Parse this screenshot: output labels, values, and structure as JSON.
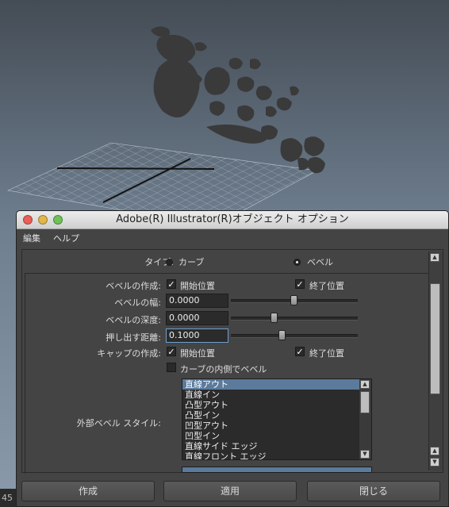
{
  "viewport": {
    "corner_number": "45"
  },
  "dialog": {
    "title": "Adobe(R) Illustrator(R)オブジェクト オプション",
    "menu": {
      "edit": "編集",
      "help": "ヘルプ"
    },
    "type": {
      "label": "タイプ:",
      "options": [
        "カーブ",
        "ベベル"
      ],
      "selected": "ベベル"
    },
    "bevel_create": {
      "label": "ベベルの作成:",
      "start": {
        "label": "開始位置",
        "checked": true
      },
      "end": {
        "label": "終了位置",
        "checked": true
      }
    },
    "bevel_width": {
      "label": "ベベルの幅:",
      "value": "0.0000",
      "slider_position": 0.5
    },
    "bevel_depth": {
      "label": "ベベルの深度:",
      "value": "0.0000",
      "slider_position": 0.33
    },
    "extrude_distance": {
      "label": "押し出す距離:",
      "value": "0.1000",
      "slider_position": 0.4
    },
    "cap_create": {
      "label": "キャップの作成:",
      "start": {
        "label": "開始位置",
        "checked": true
      },
      "end": {
        "label": "終了位置",
        "checked": true
      }
    },
    "inner_curve": {
      "label": "カーブの内側でベベル",
      "checked": false
    },
    "outer_bevel_style": {
      "label": "外部ベベル スタイル:",
      "items": [
        "直線アウト",
        "直線イン",
        "凸型アウト",
        "凸型イン",
        "凹型アウト",
        "凹型イン",
        "直線サイド エッジ",
        "直線フロント エッジ"
      ],
      "selected": "直線アウト"
    },
    "buttons": {
      "create": "作成",
      "apply": "適用",
      "close": "閉じる"
    }
  }
}
